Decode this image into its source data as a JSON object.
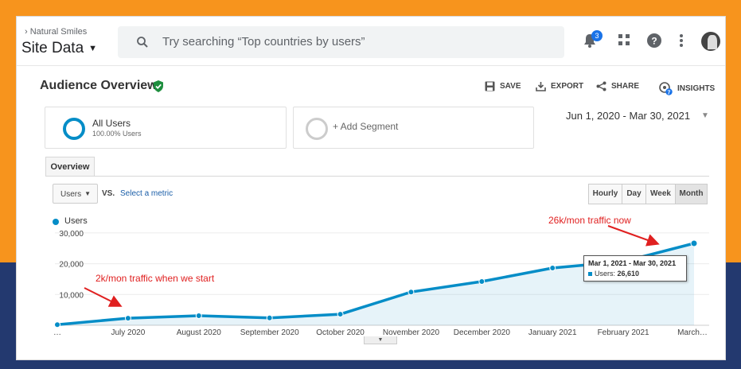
{
  "topbar": {
    "breadcrumb": "Natural Smiles",
    "property": "Site Data",
    "search_placeholder": "Try searching “Top countries by users”",
    "notification_count": "3"
  },
  "report": {
    "title": "Audience Overview",
    "actions": {
      "save": "SAVE",
      "export": "EXPORT",
      "share": "SHARE",
      "insights": "INSIGHTS"
    }
  },
  "segments": {
    "all_users_title": "All Users",
    "all_users_sub": "100.00% Users",
    "add_segment": "+ Add Segment"
  },
  "date_range": "Jun 1, 2020 - Mar 30, 2021",
  "tabs": {
    "overview": "Overview"
  },
  "controls": {
    "metric": "Users",
    "vs": "VS.",
    "select_metric": "Select a metric",
    "granularity": [
      "Hourly",
      "Day",
      "Week",
      "Month"
    ],
    "active_granularity": "Month"
  },
  "chart_data": {
    "type": "area",
    "legend": "Users",
    "y_ticks": [
      "30,000",
      "20,000",
      "10,000"
    ],
    "x_labels": [
      "…",
      "July 2020",
      "August 2020",
      "September 2020",
      "October 2020",
      "November 2020",
      "December 2020",
      "January 2021",
      "February 2021",
      "March…"
    ],
    "series": [
      {
        "name": "Users",
        "values": [
          200,
          2300,
          3100,
          2400,
          3600,
          10800,
          14200,
          18600,
          20700,
          26610
        ]
      }
    ],
    "ylim": [
      0,
      31000
    ],
    "color": "#058dc7"
  },
  "tooltip": {
    "title": "Mar 1, 2021 - Mar 30, 2021",
    "label": "Users:",
    "value": "26,610"
  },
  "annotations": {
    "start": "2k/mon traffic when we start",
    "now": "26k/mon traffic now"
  },
  "colors": {
    "orange": "#f7941d",
    "navy": "#23396f",
    "accent": "#058dc7",
    "annotation": "#e02020"
  }
}
